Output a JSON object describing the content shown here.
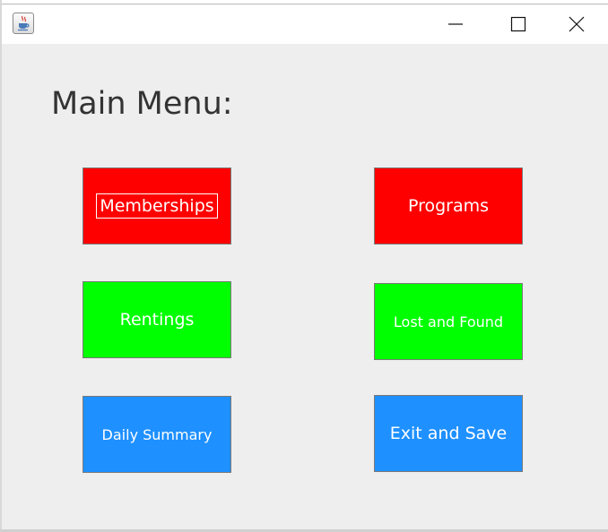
{
  "window": {
    "title": "",
    "icon": "java-cup-icon",
    "controls": {
      "minimize": "minimize-icon",
      "maximize": "maximize-icon",
      "close": "close-icon"
    }
  },
  "main": {
    "title": "Main Menu:",
    "buttons": [
      {
        "label": "Memberships",
        "color": "#ff0000",
        "focused": true
      },
      {
        "label": "Programs",
        "color": "#ff0000"
      },
      {
        "label": "Rentings",
        "color": "#00ff00"
      },
      {
        "label": "Lost and Found",
        "color": "#00ff00"
      },
      {
        "label": "Daily Summary",
        "color": "#1e90ff"
      },
      {
        "label": "Exit and Save",
        "color": "#1e90ff"
      }
    ]
  },
  "colors": {
    "background": "#eeeeee",
    "titlebar": "#ffffff",
    "text": "#333333"
  }
}
